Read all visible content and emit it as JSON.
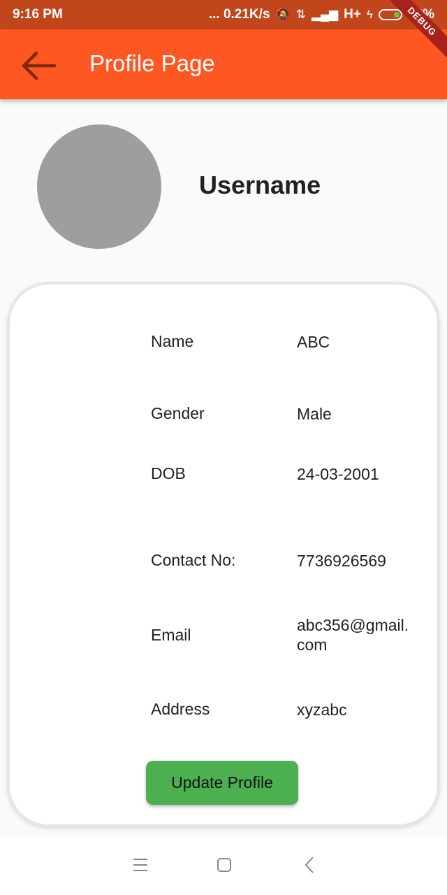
{
  "status_bar": {
    "time": "9:16 PM",
    "network_speed": "... 0.21K/s",
    "network_type": "H+",
    "battery": "13%"
  },
  "debug_banner": "DEBUG",
  "app_bar": {
    "title": "Profile Page",
    "color": "#ff5722"
  },
  "profile": {
    "username": "Username"
  },
  "details": [
    {
      "label": "Name",
      "value": "ABC"
    },
    {
      "label": "Gender",
      "value": "Male"
    },
    {
      "label": "DOB",
      "value": "24-03-2001"
    },
    {
      "label": "Contact No:",
      "value": "7736926569"
    },
    {
      "label": "Email",
      "value": "abc356@gmail.com"
    },
    {
      "label": "Address",
      "value": "xyzabc"
    }
  ],
  "update_button_label": "Update Profile",
  "colors": {
    "status_bar": "#c2461b",
    "button": "#4caf50",
    "avatar": "#9e9e9e"
  }
}
